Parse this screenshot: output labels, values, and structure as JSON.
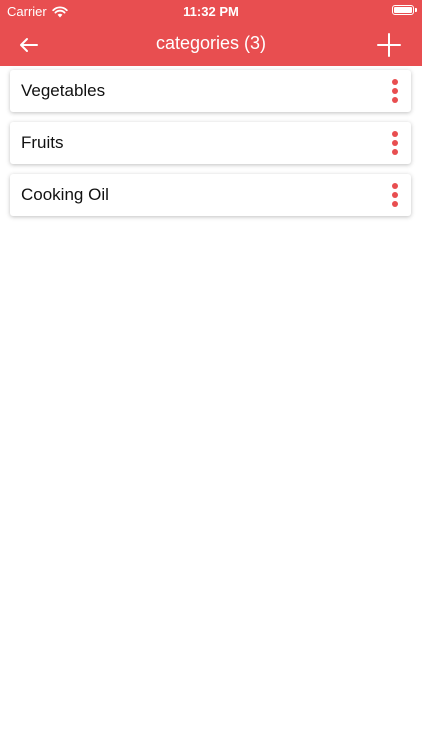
{
  "status_bar": {
    "carrier": "Carrier",
    "time": "11:32 PM"
  },
  "nav": {
    "title": "categories (3)",
    "back_icon": "arrow-left-icon",
    "add_icon": "plus-icon"
  },
  "categories": [
    {
      "label": "Vegetables"
    },
    {
      "label": "Fruits"
    },
    {
      "label": "Cooking Oil"
    }
  ],
  "colors": {
    "accent": "#e84e50",
    "text": "#111111",
    "background": "#ffffff"
  }
}
